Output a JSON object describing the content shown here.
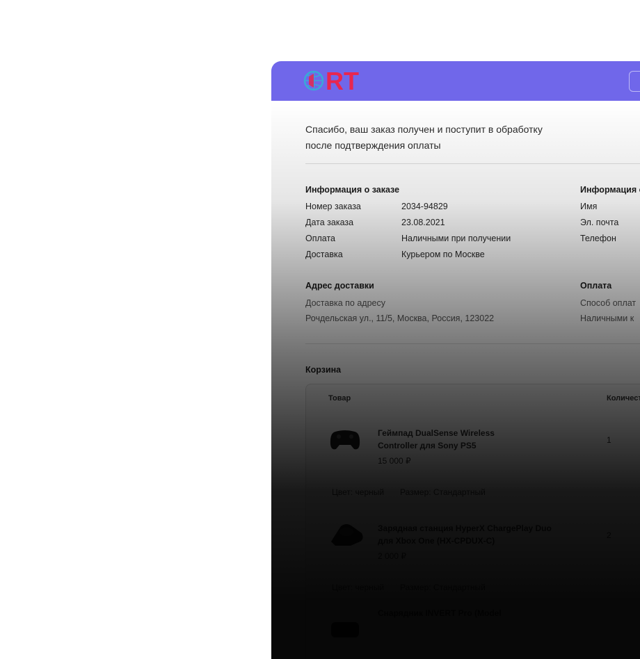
{
  "colors": {
    "topbar": "#7067ea",
    "logo_text": "#e8264f"
  },
  "brand": {
    "logo_text": "RT"
  },
  "thanks": {
    "line1": "Спасибо, ваш заказ получен и поступит в обработку",
    "line2": "после подтверждения оплаты"
  },
  "order_info": {
    "title": "Информация о заказе",
    "rows": [
      {
        "label": "Номер заказа",
        "value": "2034-94829"
      },
      {
        "label": "Дата заказа",
        "value": "23.08.2021"
      },
      {
        "label": "Оплата",
        "value": "Наличными при получении"
      },
      {
        "label": "Доставка",
        "value": "Курьером по Москве"
      }
    ]
  },
  "customer_info": {
    "title": "Информация о",
    "rows": [
      {
        "label": "Имя"
      },
      {
        "label": "Эл. почта"
      },
      {
        "label": "Телефон"
      }
    ]
  },
  "delivery_address": {
    "title": "Адрес доставки",
    "type": "Доставка по адресу",
    "address": "Рочдельская ул., 11/5, Москва, Россия, 123022"
  },
  "payment": {
    "title": "Оплата",
    "method_label": "Способ оплат",
    "method_value": "Наличными к"
  },
  "cart": {
    "title": "Корзина",
    "headers": {
      "product": "Товар",
      "quantity": "Количест"
    },
    "items": [
      {
        "name_line1": "Геймпад DualSense Wireless",
        "name_line2": "Controller для Sony PS5",
        "price": "15 000 ₽",
        "qty": "1",
        "color": "Цвет: черный",
        "size": "Размер: Стандартный",
        "icon": "gamepad-icon"
      },
      {
        "name_line1": "Зарядная станция HyperX ChargePlay Duo",
        "name_line2": "для Xbox One (HX-CPDUX-C)",
        "price": "2 000 ₽",
        "qty": "2",
        "color": "Цвет: черный",
        "size": "Размер: Стандартный",
        "icon": "charging-station-icon"
      },
      {
        "name_line1": "Снарядник INVERT Pro (Model",
        "icon": "product-icon"
      }
    ]
  }
}
